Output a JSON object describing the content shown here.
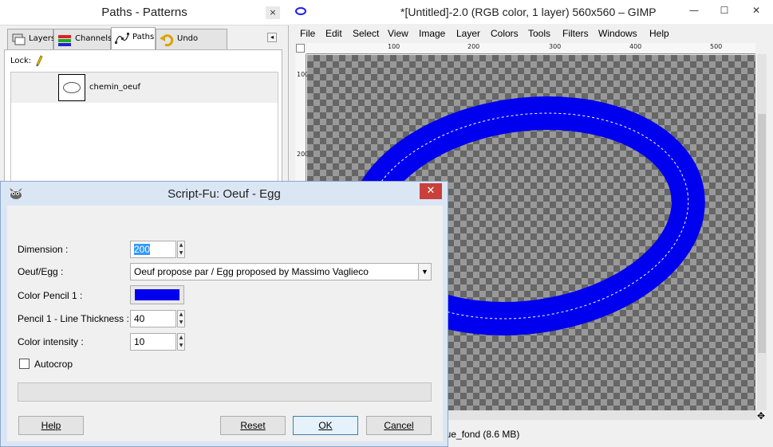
{
  "dock": {
    "title": "Paths - Patterns",
    "close": "×",
    "tabs": [
      {
        "label": "Layers",
        "icon": "layers-icon"
      },
      {
        "label": "Channels",
        "icon": "channels-icon"
      },
      {
        "label": "Paths",
        "icon": "paths-icon"
      },
      {
        "label": "Undo History",
        "icon": "undo-history-icon"
      }
    ],
    "active_tab": "Paths",
    "lock_label": "Lock:",
    "paths": [
      {
        "name": "chemin_oeuf"
      }
    ]
  },
  "image_window": {
    "title": "*[Untitled]-2.0 (RGB color, 1 layer) 560x560 – GIMP",
    "menus": [
      "File",
      "Edit",
      "Select",
      "View",
      "Image",
      "Layer",
      "Colors",
      "Tools",
      "Filters",
      "Windows",
      "Help"
    ],
    "ruler_top_labels": [
      "100",
      "200",
      "300",
      "400",
      "500"
    ],
    "ruler_left_labels": [
      "100",
      "200"
    ],
    "status": "que_fond (8.6 MB)",
    "stroke_color": "#0000ee"
  },
  "dialog": {
    "title": "Script-Fu: Oeuf - Egg",
    "close": "✕",
    "fields": {
      "dimension_label": "Dimension :",
      "dimension_value": "200",
      "egg_label": "Oeuf/Egg :",
      "egg_value": "Oeuf propose par / Egg proposed by Massimo Vaglieco",
      "color_label": "Color Pencil 1 :",
      "color_value": "#0000ee",
      "thickness_label": "Pencil 1 - Line Thickness :",
      "thickness_value": "40",
      "intensity_label": "Color intensity :",
      "intensity_value": "10",
      "autocrop_label": "Autocrop",
      "autocrop_checked": false
    },
    "buttons": {
      "help": "Help",
      "reset": "Reset",
      "ok": "OK",
      "cancel": "Cancel"
    }
  }
}
